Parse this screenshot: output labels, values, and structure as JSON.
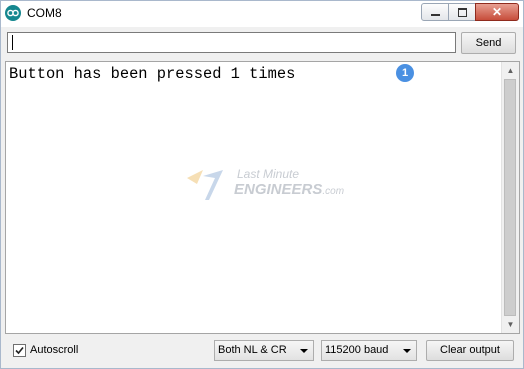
{
  "window": {
    "title": "COM8",
    "close_glyph": "✕"
  },
  "input": {
    "value": "",
    "send_label": "Send"
  },
  "output": {
    "lines": [
      "Button has been pressed 1 times"
    ],
    "badge": "1"
  },
  "watermark": {
    "line1": "Last Minute",
    "line2": "ENGINEERS",
    "line2_suffix": ".com"
  },
  "footer": {
    "autoscroll_label": "Autoscroll",
    "autoscroll_checked": true,
    "line_ending": "Both NL & CR",
    "baud_rate": "115200 baud",
    "clear_label": "Clear output"
  },
  "colors": {
    "accent": "#15878f",
    "badge": "#4a90e2",
    "close": "#c74d3b"
  }
}
